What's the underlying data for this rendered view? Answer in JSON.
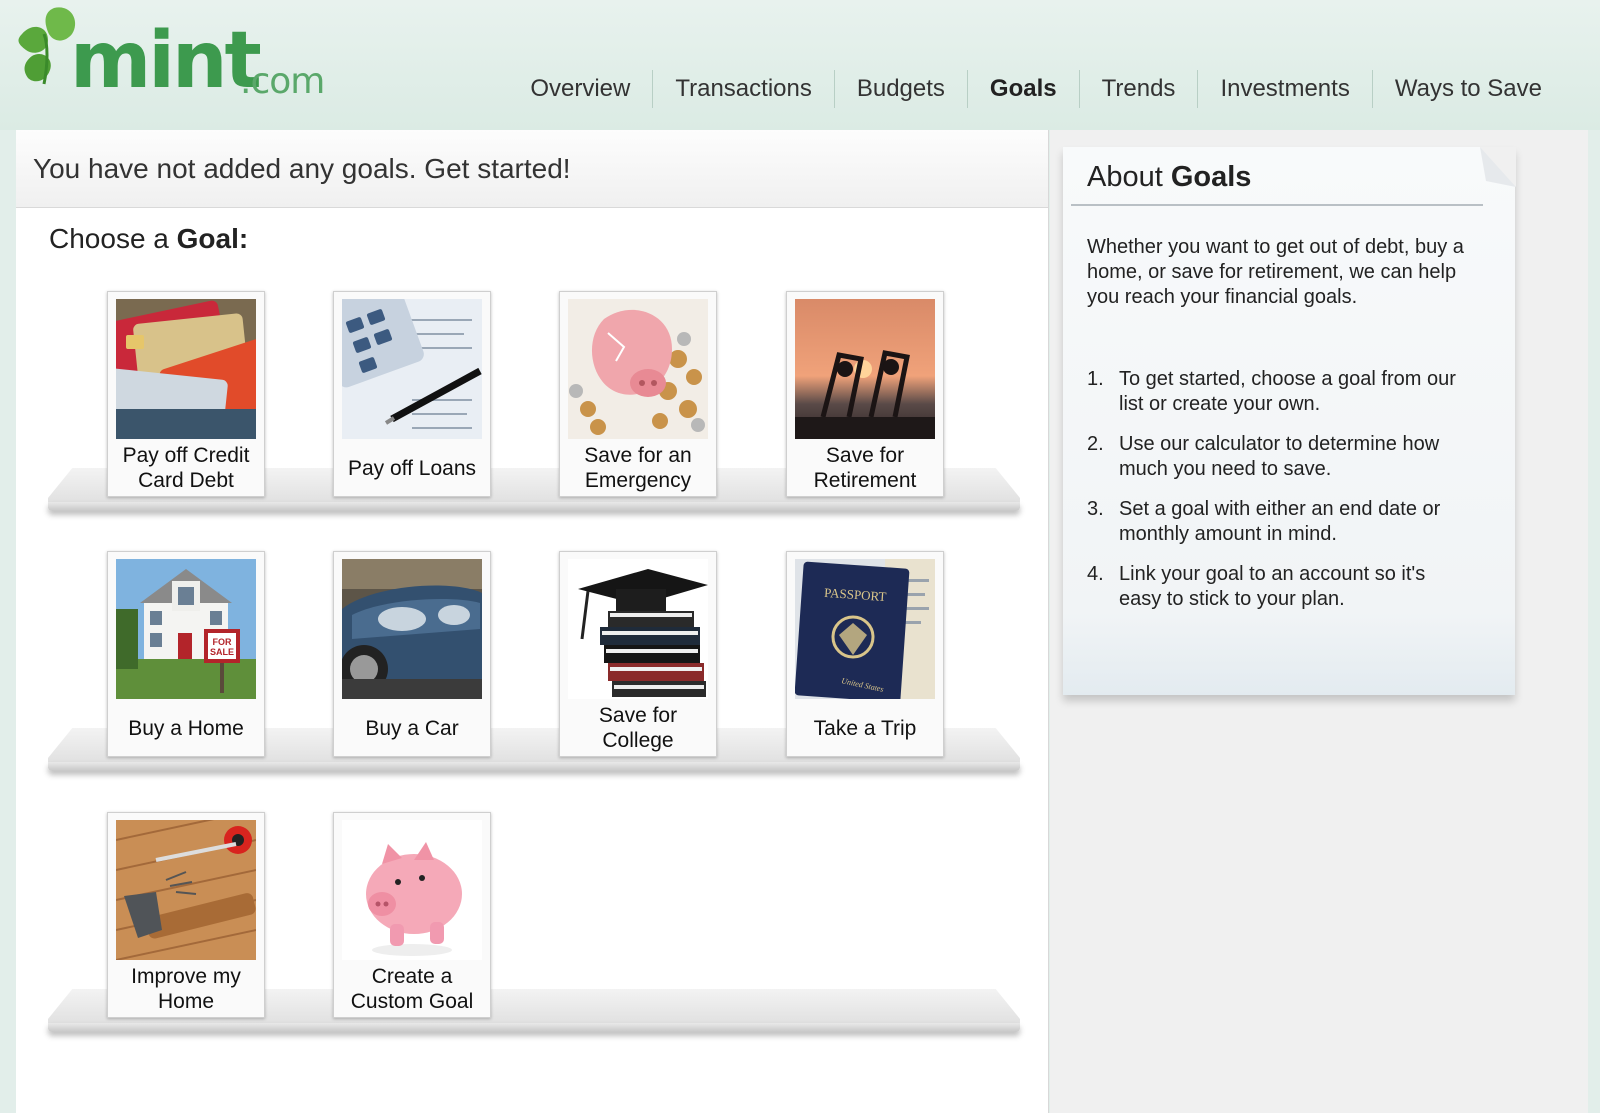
{
  "brand": {
    "name": "mint",
    "suffix": ".com"
  },
  "nav": [
    {
      "label": "Overview",
      "active": false
    },
    {
      "label": "Transactions",
      "active": false
    },
    {
      "label": "Budgets",
      "active": false
    },
    {
      "label": "Goals",
      "active": true
    },
    {
      "label": "Trends",
      "active": false
    },
    {
      "label": "Investments",
      "active": false
    },
    {
      "label": "Ways to Save",
      "active": false
    }
  ],
  "main": {
    "banner": "You have not added any goals. Get started!",
    "choose_prefix": "Choose a ",
    "choose_bold": "Goal:",
    "goals": [
      {
        "label": "Pay off Credit Card Debt",
        "image": "credit-cards-image"
      },
      {
        "label": "Pay off Loans",
        "image": "calculator-image"
      },
      {
        "label": "Save for an Emergency",
        "image": "broken-piggy-bank-image"
      },
      {
        "label": "Save for Retirement",
        "image": "beach-sunset-image"
      },
      {
        "label": "Buy a Home",
        "image": "house-for-sale-image"
      },
      {
        "label": "Buy a Car",
        "image": "car-image"
      },
      {
        "label": "Save for College",
        "image": "graduation-cap-books-image"
      },
      {
        "label": "Take a Trip",
        "image": "passport-image"
      },
      {
        "label": "Improve my Home",
        "image": "hammer-tools-image"
      },
      {
        "label": "Create a Custom Goal",
        "image": "piggy-bank-image"
      }
    ]
  },
  "about": {
    "title_prefix": "About ",
    "title_bold": "Goals",
    "intro": "Whether you want to get out of debt, buy a home, or save for retirement, we can help you reach your financial goals.",
    "steps": [
      {
        "num": "1.",
        "text": "To get started, choose a goal from our list or create your own."
      },
      {
        "num": "2.",
        "text": "Use our calculator to determine how much you need to save."
      },
      {
        "num": "3.",
        "text": "Set a goal with either an end date or monthly amount in mind."
      },
      {
        "num": "4.",
        "text": "Link your goal to an account so it's easy to stick to your plan."
      }
    ]
  },
  "colors": {
    "brand_green": "#3d9a4e",
    "header_bg": "#e2eeea"
  }
}
